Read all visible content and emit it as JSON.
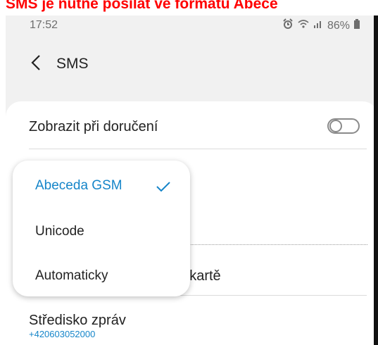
{
  "banner": {
    "text": "SMS je nutné posílat ve formátu Abece"
  },
  "statusbar": {
    "time": "17:52",
    "battery": "86%",
    "icons": [
      "alarm-icon",
      "wifi-icon",
      "signal-icon",
      "battery-icon"
    ]
  },
  "appbar": {
    "title": "SMS",
    "back_icon": "chevron-left-icon"
  },
  "settings": {
    "delivery_label": "Zobrazit při doručení",
    "sim_label_partial": "M kartě",
    "center_label": "Středisko zpráv",
    "center_value": "+420603052000"
  },
  "popup": {
    "options": [
      {
        "label": "Abeceda GSM",
        "selected": true
      },
      {
        "label": "Unicode",
        "selected": false
      },
      {
        "label": "Automaticky",
        "selected": false
      }
    ],
    "check_icon": "checkmark-icon"
  },
  "colors": {
    "accent": "#1585c9",
    "banner": "#ff0000",
    "background": "#f1f1f1"
  }
}
